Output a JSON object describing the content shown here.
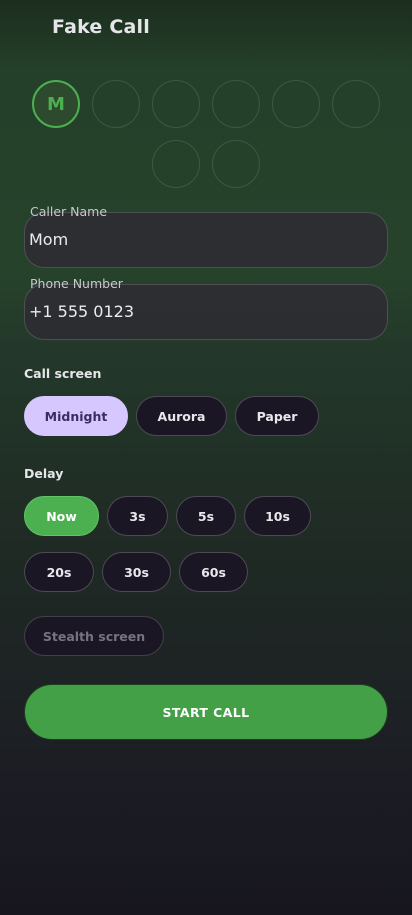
{
  "header": {
    "title": "Fake Call"
  },
  "avatars": [
    {
      "initial": "M",
      "selected": true
    },
    {
      "initial": "",
      "selected": false
    },
    {
      "initial": "",
      "selected": false
    },
    {
      "initial": "",
      "selected": false
    },
    {
      "initial": "",
      "selected": false
    },
    {
      "initial": "",
      "selected": false
    },
    {
      "initial": "",
      "selected": false
    },
    {
      "initial": "",
      "selected": false
    }
  ],
  "caller_name": {
    "label": "Caller Name",
    "value": "Mom"
  },
  "phone_number": {
    "label": "Phone Number",
    "value": "+1 555 0123"
  },
  "call_screen": {
    "label": "Call screen",
    "options": [
      "Midnight",
      "Aurora",
      "Paper"
    ],
    "selected": "Midnight"
  },
  "delay": {
    "label": "Delay",
    "options": [
      "Now",
      "3s",
      "5s",
      "10s",
      "20s",
      "30s",
      "60s"
    ],
    "selected": "Now"
  },
  "stealth": {
    "label": "Stealth screen"
  },
  "start_button": {
    "label": "START CALL"
  },
  "colors": {
    "accent_green": "#4caf50",
    "theme_selected": "#d6c8ff",
    "chip_bg": "#1a1624"
  }
}
